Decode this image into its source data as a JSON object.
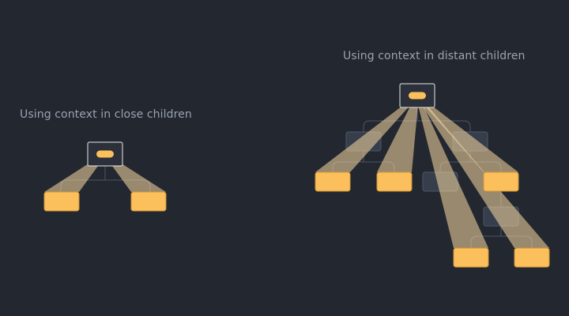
{
  "captions": {
    "close": "Using context in close children",
    "distant": "Using context in distant children"
  },
  "colors": {
    "background": "#23272f",
    "caption": "#9aa3b2",
    "consumer_fill": "#fbbf5c",
    "consumer_stroke": "#cf9636",
    "provider_border": "#e8e8e8",
    "ghost_node_fill": "#3a4150",
    "ghost_node_stroke": "#566072",
    "connector": "#4d5566",
    "beam": "#fbdca4",
    "provider_pill": "#fbbf5c"
  },
  "diagrams": [
    {
      "name": "close-children",
      "provider": "context-provider",
      "consumers": [
        "child-1",
        "child-2"
      ],
      "ghost_nodes": []
    },
    {
      "name": "distant-children",
      "provider": "context-provider",
      "consumers": [
        "leaf-1",
        "leaf-2",
        "leaf-3",
        "leaf-4",
        "leaf-5"
      ],
      "ghost_nodes": [
        "intermediate-1",
        "intermediate-2",
        "intermediate-3",
        "intermediate-4"
      ]
    }
  ]
}
